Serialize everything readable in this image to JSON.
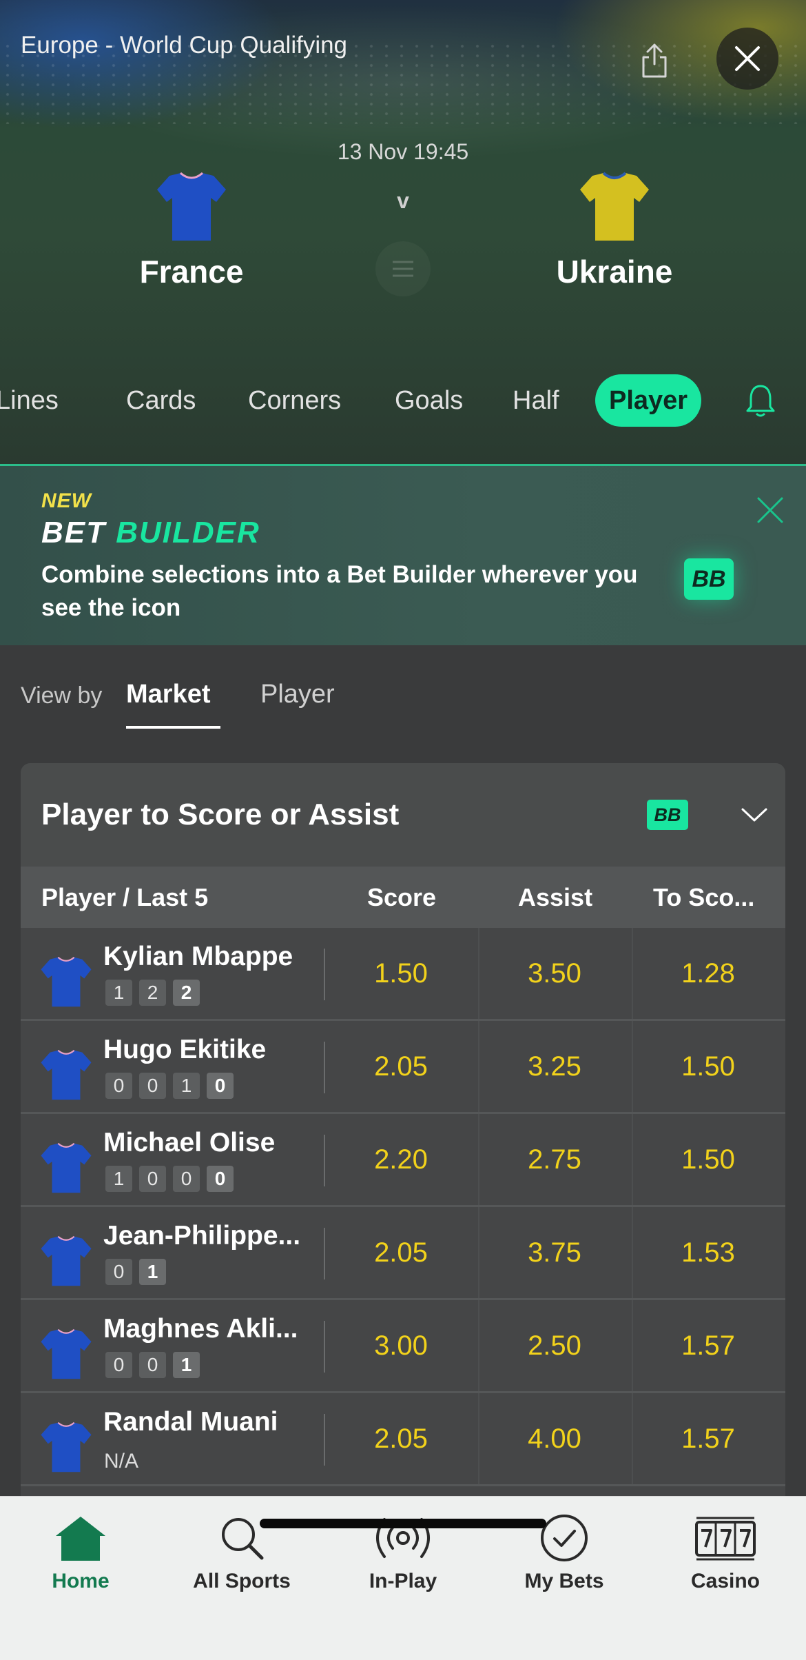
{
  "header": {
    "competition": "Europe - World Cup Qualifying",
    "kickoff": "13 Nov 19:45",
    "vs": "v",
    "home_team": "France",
    "away_team": "Ukraine",
    "home_shirt_color": "#1f4fc4",
    "away_shirt_color": "#d4c020"
  },
  "tabs": {
    "items": [
      "Lines",
      "Cards",
      "Corners",
      "Goals",
      "Half",
      "Player"
    ],
    "active": "Player"
  },
  "banner": {
    "new_label": "NEW",
    "title_part1": "BET",
    "title_part2": "BUILDER",
    "description": "Combine selections into a Bet Builder wherever you see the icon",
    "badge": "BB"
  },
  "view_by": {
    "label": "View by",
    "options": [
      "Market",
      "Player"
    ],
    "active": "Market"
  },
  "market": {
    "title": "Player to Score or Assist",
    "badge": "BB",
    "columns": [
      "Player / Last 5",
      "Score",
      "Assist",
      "To Sco..."
    ],
    "rows": [
      {
        "name": "Kylian Mbappe",
        "form": [
          "1",
          "2",
          "2"
        ],
        "score": "1.50",
        "assist": "3.50",
        "to_score": "1.28"
      },
      {
        "name": "Hugo Ekitike",
        "form": [
          "0",
          "0",
          "1",
          "0"
        ],
        "score": "2.05",
        "assist": "3.25",
        "to_score": "1.50"
      },
      {
        "name": "Michael Olise",
        "form": [
          "1",
          "0",
          "0",
          "0"
        ],
        "score": "2.20",
        "assist": "2.75",
        "to_score": "1.50"
      },
      {
        "name": "Jean-Philippe...",
        "form": [
          "0",
          "1"
        ],
        "score": "2.05",
        "assist": "3.75",
        "to_score": "1.53"
      },
      {
        "name": "Maghnes Akli...",
        "form": [
          "0",
          "0",
          "1"
        ],
        "score": "3.00",
        "assist": "2.50",
        "to_score": "1.57"
      },
      {
        "name": "Randal Muani",
        "form_text": "N/A",
        "score": "2.05",
        "assist": "4.00",
        "to_score": "1.57"
      }
    ]
  },
  "bottom_nav": {
    "items": [
      "Home",
      "All Sports",
      "In-Play",
      "My Bets",
      "Casino"
    ],
    "active": "Home"
  },
  "colors": {
    "accent": "#19e6a0",
    "odds": "#f2d21b",
    "nav_active": "#137a4f"
  }
}
